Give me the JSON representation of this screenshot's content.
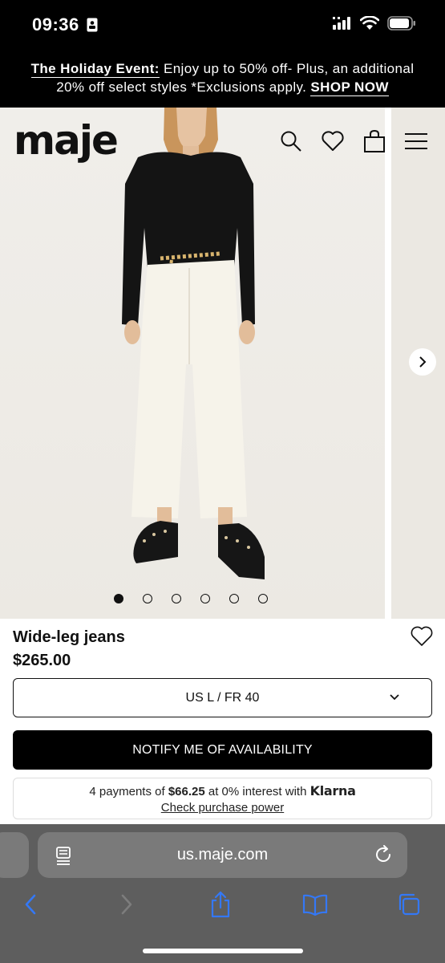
{
  "status_bar": {
    "time": "09:36"
  },
  "promo": {
    "title": "The Holiday Event:",
    "line1_rest": " Enjoy up to 50% off- Plus, an additional",
    "line2": "20% off select styles *Exclusions apply. ",
    "cta": "SHOP NOW"
  },
  "header": {
    "logo": "maje",
    "icons": [
      "search-icon",
      "heart-icon",
      "bag-icon",
      "menu-icon"
    ]
  },
  "carousel": {
    "image_count": 6,
    "active_index": 0
  },
  "product": {
    "name": "Wide-leg jeans",
    "price": "$265.00",
    "size_selected": "US L / FR 40",
    "notify_label": "NOTIFY ME OF AVAILABILITY",
    "klarna": {
      "prefix": "4 payments of ",
      "amount": "$66.25",
      "middle": " at 0% interest with ",
      "brand": "Klarna",
      "link": "Check purchase power"
    }
  },
  "browser": {
    "url": "us.maje.com"
  },
  "colors": {
    "accent": "#000000",
    "browser_tint": "#5e5e5e",
    "link_blue": "#3478f6"
  }
}
